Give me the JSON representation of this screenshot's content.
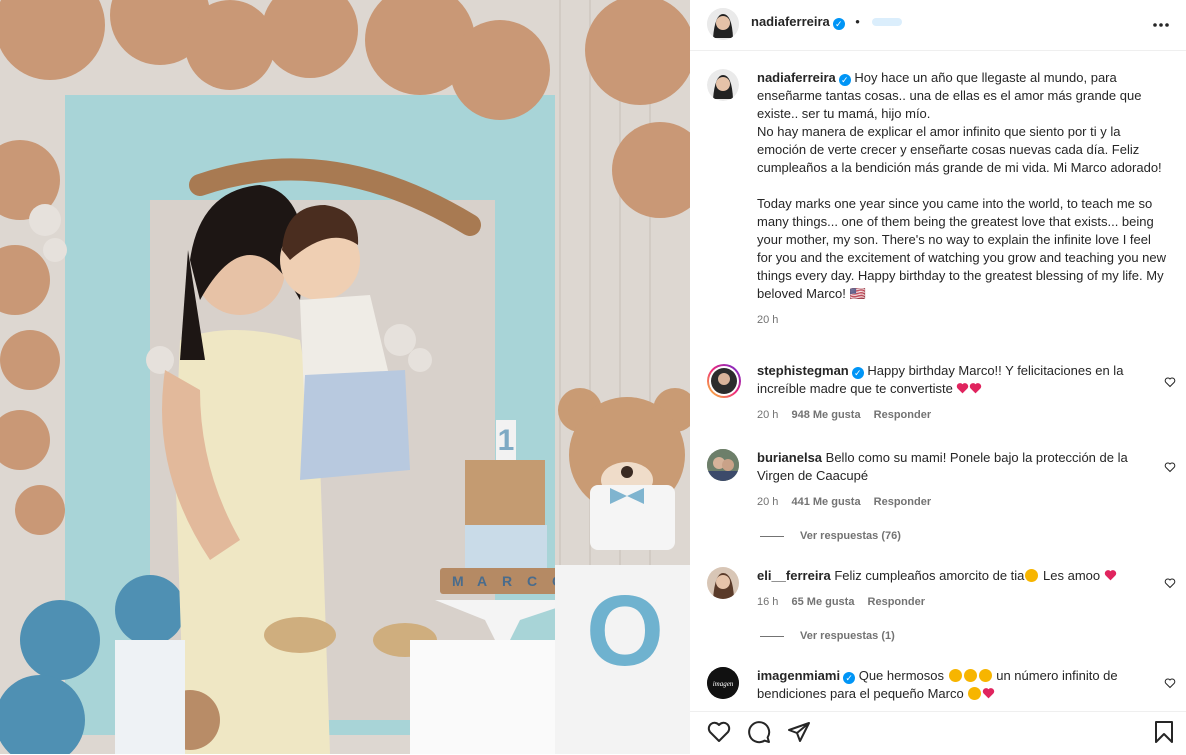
{
  "post": {
    "author": "nadiaferreira",
    "header_dot": "•"
  },
  "caption": {
    "author": "nadiaferreira",
    "text_es": "Hoy hace un año que llegaste al mundo, para enseñarme tantas cosas.. una de ellas es el amor más grande que existe.. ser tu mamá, hijo mío.\nNo hay manera de explicar el amor infinito que siento por ti y la emoción de verte crecer y enseñarte cosas nuevas cada día. Feliz cumpleaños a la bendición más grande de mi vida. Mi Marco adorado!",
    "text_en": "Today marks one year since you came into the world, to teach me so many things... one of them being the greatest love that exists... being your mother, my son. There's no way to explain the infinite love I feel for you and the excitement of watching you grow and teaching you new things every day. Happy birthday to the greatest blessing of my life. My beloved Marco! 🇺🇸",
    "time": "20 h"
  },
  "comments": [
    {
      "user": "stephistegman",
      "text": "Happy birthday Marco!! Y felicitaciones en la increíble madre que te convertiste",
      "time": "20 h",
      "likes": "948 Me gusta",
      "reply": "Responder"
    },
    {
      "user": "burianelsa",
      "text": "Bello como su mami! Ponele bajo la protección de la Virgen de Caacupé",
      "time": "20 h",
      "likes": "441 Me gusta",
      "reply": "Responder",
      "view_replies": "Ver respuestas (76)"
    },
    {
      "user": "eli__ferreira",
      "text_a": "Feliz cumpleaños amorcito de tia",
      "text_b": "Les amoo",
      "time": "16 h",
      "likes": "65 Me gusta",
      "reply": "Responder",
      "view_replies": "Ver respuestas (1)"
    },
    {
      "user": "imagenmiami",
      "text_a": "Que hermosos",
      "text_b": "un número infinito de bendiciones para el pequeño Marco"
    }
  ],
  "photo": {
    "cake_number": "1",
    "cake_letters": [
      "M",
      "A",
      "R",
      "C",
      "O"
    ],
    "cube_letter": "O",
    "avatar_label": "imagen"
  },
  "colors": {
    "verified": "#0095f6",
    "heart": "#ff3040",
    "muted": "#737373"
  }
}
